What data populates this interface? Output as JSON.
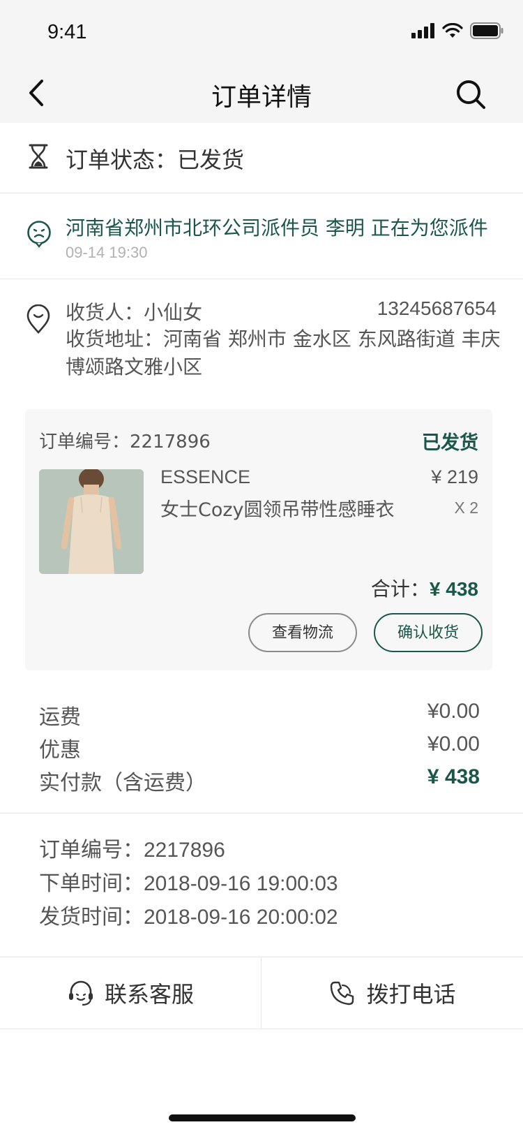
{
  "status_bar": {
    "time": "9:41"
  },
  "nav": {
    "title": "订单详情"
  },
  "order_status": {
    "label": "订单状态：",
    "value": "已发货"
  },
  "courier": {
    "message": "河南省郑州市北环公司派件员 李明 正在为您派件",
    "time": "09-14   19:30"
  },
  "receiver": {
    "name": "收货人：小仙女",
    "phone": "13245687654",
    "address": "收货地址：河南省 郑州市 金水区 东风路街道 丰庆博颂路文雅小区"
  },
  "order_card": {
    "order_no": "订单编号：2217896",
    "status": "已发货",
    "product": {
      "brand": "ESSENCE",
      "name": "女士Cozy圆领吊带性感睡衣",
      "price": "¥ 219",
      "qty": "X 2"
    },
    "total_label": "合计：",
    "total_value": "¥ 438",
    "btn_logistics": "查看物流",
    "btn_confirm": "确认收货"
  },
  "fees": {
    "shipping_label": "运费",
    "shipping_value": "¥0.00",
    "discount_label": "优惠",
    "discount_value": "¥0.00",
    "paid_label": "实付款（含运费）",
    "paid_value": "¥ 438"
  },
  "info": {
    "order_no_label": "订单编号：",
    "order_no_value": "2217896",
    "created_label": "下单时间：",
    "created_value": "2018-09-16 19:00:03",
    "shipped_label": "发货时间：",
    "shipped_value": "2018-09-16 20:00:02"
  },
  "actions": {
    "service": "联系客服",
    "call": "拨打电话"
  },
  "colors": {
    "accent": "#1b5749",
    "muted": "#b1b1b1",
    "card_bg": "#f7f7f7"
  },
  "icons": [
    "back-icon",
    "search-icon",
    "hourglass-icon",
    "courier-face-icon",
    "location-pin-icon",
    "headset-icon",
    "phone-icon"
  ]
}
